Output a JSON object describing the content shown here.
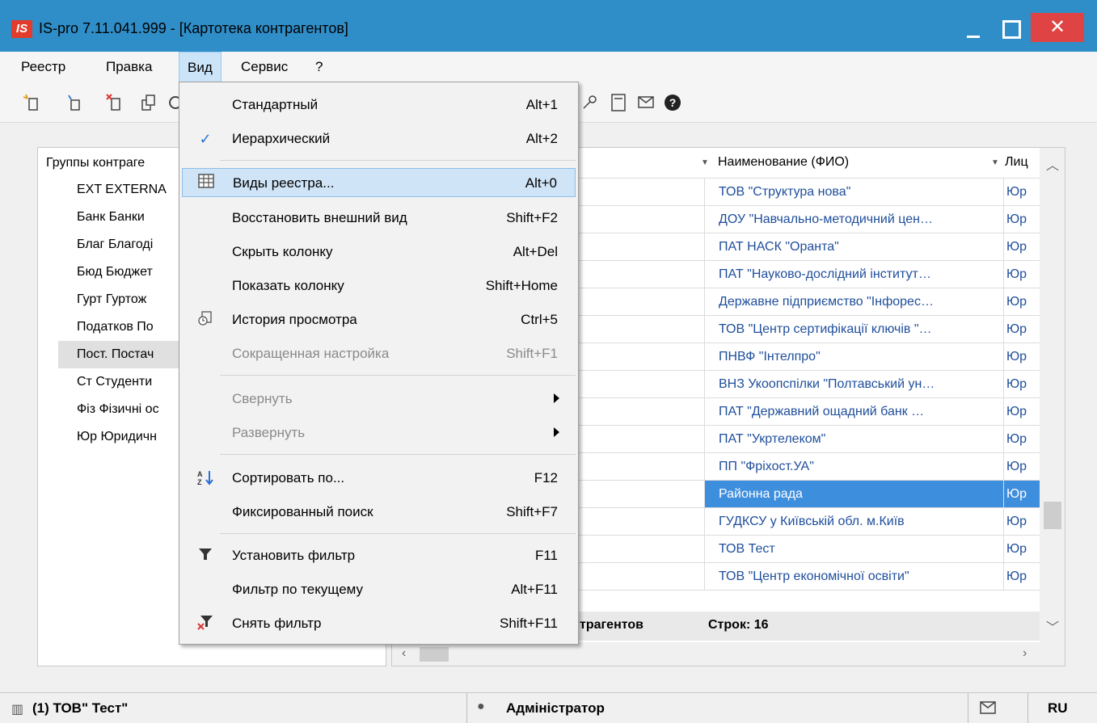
{
  "window": {
    "app_logo": "IS",
    "title": "IS-pro 7.11.041.999 - [Картотека контрагентов]",
    "close_glyph": "✕"
  },
  "menubar": {
    "items": [
      "Реестр",
      "Правка",
      "Вид",
      "Сервис",
      "?"
    ],
    "active": "Вид"
  },
  "toolbar": {
    "icons": [
      "add-icon",
      "add-subitem-icon",
      "delete-icon",
      "copy-icon",
      "refresh-icon",
      "key-icon",
      "form-icon",
      "mail-icon",
      "help-icon"
    ]
  },
  "left_panel": {
    "header": "Группы контраге",
    "groups": [
      "EXT EXTERNA",
      "Банк Банки",
      "Благ Благоді",
      "Бюд Бюджет",
      "Гурт Гуртож",
      "Податков По",
      "Пост. Постач",
      "Ст Студенти",
      "Фіз Фізичні ос",
      "Юр Юридичн"
    ],
    "selected_index": 6
  },
  "grid": {
    "columns": [
      "Наименование (ФИО)",
      "Лиц"
    ],
    "rows": [
      {
        "name": "ТОВ \"Структура нова\"",
        "type": "Юр"
      },
      {
        "name": "ДОУ \"Навчально-методичний цен…",
        "type": "Юр"
      },
      {
        "name": "ПАТ  НАСК \"Оранта\"",
        "type": "Юр"
      },
      {
        "name": "ПАТ \"Науково-дослідний інститут…",
        "type": "Юр"
      },
      {
        "name": "Державне підприємство \"Інфорес…",
        "type": "Юр"
      },
      {
        "name": "ТОВ \"Центр сертифікації ключів \"…",
        "type": "Юр"
      },
      {
        "name": "ПНВФ \"Інтелпро\"",
        "type": "Юр"
      },
      {
        "name": "ВНЗ Укоопспілки \"Полтавський ун…",
        "type": "Юр"
      },
      {
        "name": "ПАТ  \"Державний ощадний банк …",
        "type": "Юр"
      },
      {
        "name": "ПАТ \"Укртелеком\"",
        "type": "Юр"
      },
      {
        "name": "ПП \"Фріхост.УА\"",
        "type": "Юр"
      },
      {
        "name": "Районна рада",
        "type": "Юр"
      },
      {
        "name": "ГУДКСУ у Київській обл. м.Київ",
        "type": "Юр"
      },
      {
        "name": "ТОВ Тест",
        "type": "Юр"
      },
      {
        "name": "ТОВ \"Центр економічної освіти\"",
        "type": "Юр"
      }
    ],
    "selected_row": 11,
    "footer_label": "трагентов",
    "footer_count": "Строк: 16"
  },
  "statusbar": {
    "org": "(1) ТОВ\" Тест\"",
    "user": "Адміністратор",
    "lang": "RU"
  },
  "view_menu": {
    "items": [
      {
        "label": "Стандартный",
        "shortcut": "Alt+1"
      },
      {
        "label": "Иерархический",
        "shortcut": "Alt+2",
        "checked": true
      },
      {
        "label": "Виды реестра...",
        "shortcut": "Alt+0",
        "icon": "table-icon",
        "hover": true
      },
      {
        "label": "Восстановить внешний вид",
        "shortcut": "Shift+F2"
      },
      {
        "label": "Скрыть колонку",
        "shortcut": "Alt+Del"
      },
      {
        "label": "Показать колонку",
        "shortcut": "Shift+Home"
      },
      {
        "label": "История просмотра",
        "shortcut": "Ctrl+5",
        "icon": "history-icon"
      },
      {
        "label": "Сокращенная настройка",
        "shortcut": "Shift+F1",
        "disabled": true
      },
      {
        "label": "Свернуть",
        "shortcut": "",
        "disabled": true,
        "submenu": true
      },
      {
        "label": "Развернуть",
        "shortcut": "",
        "disabled": true,
        "submenu": true
      },
      {
        "label": "Сортировать по...",
        "shortcut": "F12",
        "icon": "sort-icon"
      },
      {
        "label": "Фиксированный поиск",
        "shortcut": "Shift+F7"
      },
      {
        "label": "Установить фильтр",
        "shortcut": "F11",
        "icon": "filter-icon"
      },
      {
        "label": "Фильтр по текущему",
        "shortcut": "Alt+F11"
      },
      {
        "label": "Снять фильтр",
        "shortcut": "Shift+F11",
        "icon": "clear-filter-icon"
      }
    ]
  },
  "colors": {
    "titlebar": "#2f8ec8",
    "selection": "#3e8ede",
    "menu_hover": "#cfe4f7",
    "close_button": "#e04343",
    "grid_text": "#1f4e9b"
  }
}
